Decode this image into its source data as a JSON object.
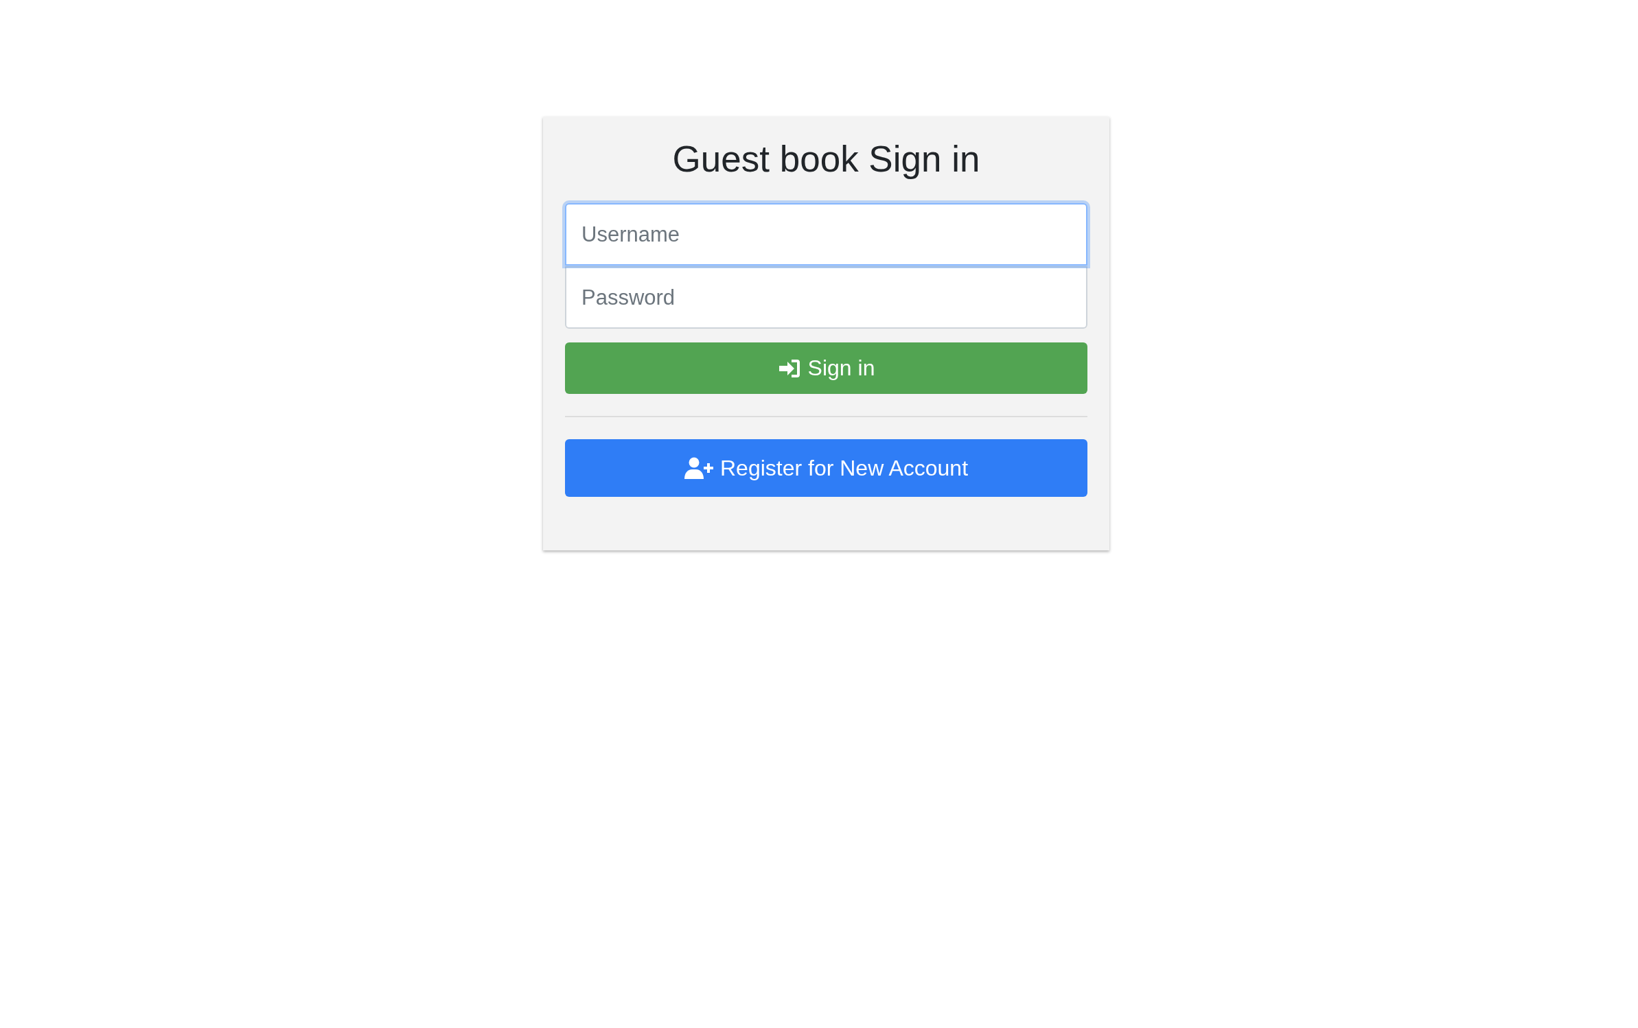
{
  "title": "Guest book Sign in",
  "fields": [
    {
      "placeholder": "Username",
      "focused": true
    },
    {
      "placeholder": "Password",
      "focused": false
    }
  ],
  "buttons": [
    {
      "label": "Sign in",
      "kind": "signin"
    },
    {
      "label": "Register for New Account",
      "kind": "register"
    }
  ]
}
